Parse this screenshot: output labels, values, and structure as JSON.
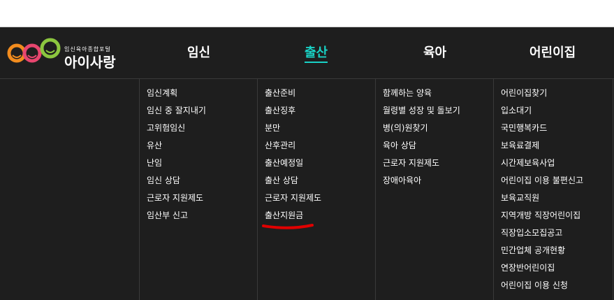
{
  "logo": {
    "tagline": "임신육아종합포털",
    "name": "아이사랑"
  },
  "nav": [
    {
      "label": "임신",
      "active": false
    },
    {
      "label": "출산",
      "active": true
    },
    {
      "label": "육아",
      "active": false
    },
    {
      "label": "어린이집",
      "active": false
    }
  ],
  "menus": {
    "pregnancy": [
      "임신계획",
      "임신 중 잘지내기",
      "고위험임신",
      "유산",
      "난임",
      "임신 상담",
      "근로자 지원제도",
      "임산부 신고"
    ],
    "birth": [
      "출산준비",
      "출산징후",
      "분만",
      "산후관리",
      "출산예정일",
      "출산 상담",
      "근로자 지원제도",
      "출산지원금"
    ],
    "parenting": [
      "함께하는 양육",
      "월령별 성장 및 돌보기",
      "병(의)원찾기",
      "육아 상담",
      "근로자 지원제도",
      "장애아육아"
    ],
    "daycare": [
      "어린이집찾기",
      "입소대기",
      "국민행복카드",
      "보육료결제",
      "시간제보육사업",
      "어린이집 이용 불편신고",
      "보육교직원",
      "지역개방 직장어린이집",
      "직장입소모집공고",
      "민간업체 공개현황",
      "연장반어린이집",
      "어린이집 이용 신청"
    ]
  },
  "colors": {
    "background": "#1e1e1e",
    "active": "#19d2c6",
    "annotation": "#e00000"
  }
}
